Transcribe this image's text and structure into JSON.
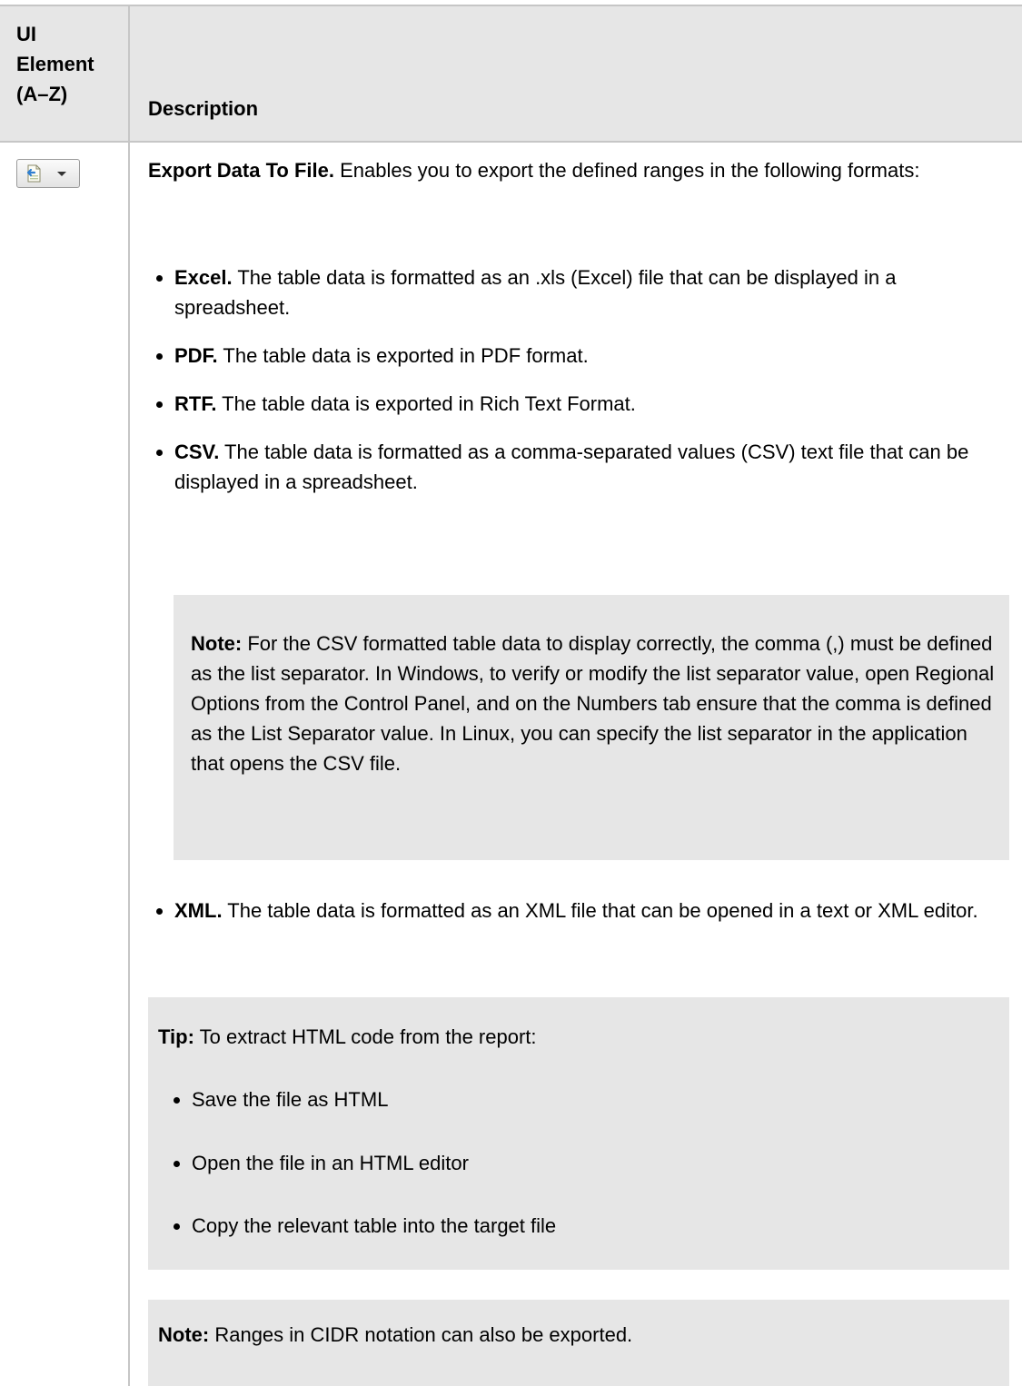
{
  "table": {
    "header": {
      "col1": "UI\nElement\n(A–Z)",
      "col2": "Description"
    },
    "row": {
      "icon": "export-data-to-file-icon",
      "intro_title": "Export Data To File.",
      "intro_text": " Enables you to export the defined ranges in the following formats:",
      "formats": [
        {
          "name": "Excel.",
          "text": " The table data is formatted as an .xls (Excel) file that can be displayed in a spreadsheet."
        },
        {
          "name": "PDF.",
          "text": " The table data is exported in PDF format."
        },
        {
          "name": "RTF.",
          "text": " The table data is exported in Rich Text Format."
        },
        {
          "name": "CSV.",
          "text": " The table data is formatted as a comma-separated values (CSV) text file that can be displayed in a spreadsheet."
        }
      ],
      "csv_note_label": "Note:",
      "csv_note_text": " For the CSV formatted table data to display correctly, the comma (,) must be defined as the list separator. In Windows, to verify or modify the list separator value, open Regional Options from the Control Panel, and on the Numbers tab ensure that the comma is defined as the List Separator value. In Linux, you can specify the list separator in the application that opens the CSV file.",
      "xml_format": {
        "name": "XML.",
        "text": " The table data is formatted as an XML file that can be opened in a text or XML editor."
      },
      "tip_label": "Tip:",
      "tip_text": " To extract HTML code from the report:",
      "tip_steps": [
        "Save the file as HTML",
        "Open the file in an HTML editor",
        "Copy the relevant table into the target file"
      ],
      "cidr_note_label": "Note:",
      "cidr_note_text": " Ranges in CIDR notation can also be exported."
    }
  },
  "colors": {
    "header_bg": "#e6e6e6",
    "note_bg": "#e6e6e6",
    "border": "#c6c6c6"
  }
}
